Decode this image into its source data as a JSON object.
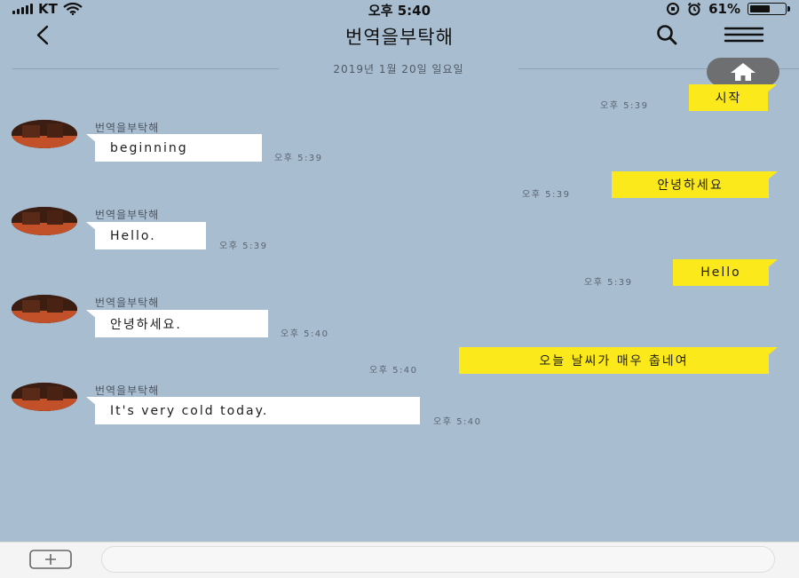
{
  "status_bar": {
    "carrier": "KT",
    "time": "오후 5:40",
    "battery_percent": "61%",
    "battery_level": 0.61
  },
  "header": {
    "title": "번역을부탁해",
    "back_icon": "chevron-left-icon",
    "search_icon": "search-icon",
    "menu_icon": "hamburger-menu-icon"
  },
  "chat": {
    "date_divider": "2019년 1월 20일 일요일",
    "home_icon": "home-icon",
    "sender_name": "번역을부탁해",
    "messages": [
      {
        "side": "me",
        "text": "시작",
        "time": "오후 5:39"
      },
      {
        "side": "bot",
        "text": "beginning",
        "time": "오후 5:39"
      },
      {
        "side": "me",
        "text": "안녕하세요",
        "time": "오후 5:39"
      },
      {
        "side": "bot",
        "text": "Hello.",
        "time": "오후 5:39"
      },
      {
        "side": "me",
        "text": "Hello",
        "time": "오후 5:39"
      },
      {
        "side": "bot",
        "text": "안녕하세요.",
        "time": "오후 5:40"
      },
      {
        "side": "me",
        "text": "오늘 날씨가 매우 춥네여",
        "time": "오후 5:40"
      },
      {
        "side": "bot",
        "text": "It's very cold today.",
        "time": "오후 5:40"
      }
    ]
  },
  "composer": {
    "attach_icon": "plus-square-icon",
    "input_value": ""
  },
  "colors": {
    "background": "#a9bdd0",
    "my_bubble": "#fbe91c",
    "bot_bubble": "#ffffff"
  }
}
